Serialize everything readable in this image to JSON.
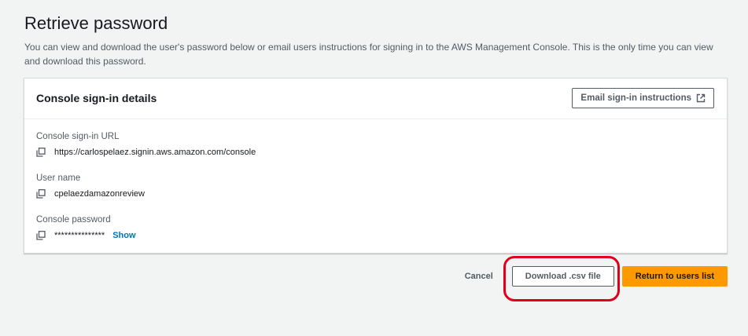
{
  "header": {
    "title": "Retrieve password",
    "description": "You can view and download the user's password below or email users instructions for signing in to the AWS Management Console. This is the only time you can view and download this password."
  },
  "panel": {
    "title": "Console sign-in details",
    "email_button_label": "Email sign-in instructions",
    "fields": [
      {
        "label": "Console sign-in URL",
        "value": "https://carlospelaez.signin.aws.amazon.com/console"
      },
      {
        "label": "User name",
        "value": "cpelaezdamazonreview"
      },
      {
        "label": "Console password",
        "value": "***************",
        "show_label": "Show"
      }
    ]
  },
  "actions": {
    "cancel_label": "Cancel",
    "download_label": "Download .csv file",
    "return_label": "Return to users list"
  },
  "colors": {
    "primary_button": "#ff9900",
    "link": "#0073bb",
    "highlight": "#e0001b"
  }
}
